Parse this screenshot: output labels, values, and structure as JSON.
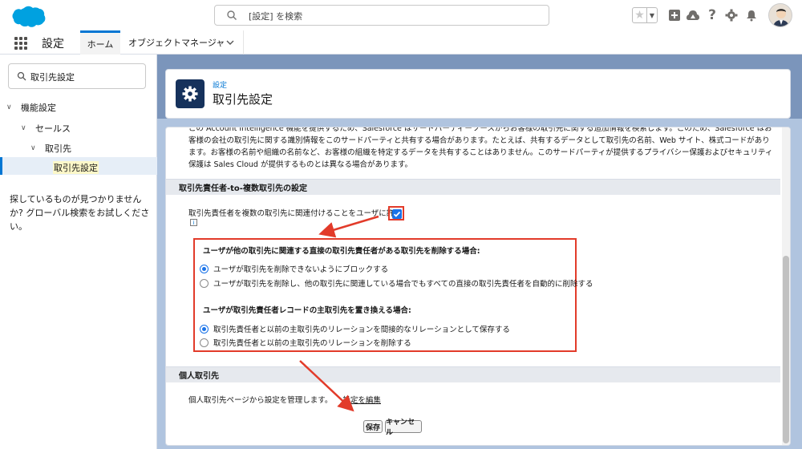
{
  "header": {
    "search_placeholder": "[設定] を検索"
  },
  "nav": {
    "app_name": "設定",
    "tabs": [
      {
        "label": "ホーム"
      },
      {
        "label": "オブジェクトマネージャ"
      }
    ]
  },
  "sidebar": {
    "quick_find_value": "取引先設定",
    "tree": [
      {
        "label": "機能設定"
      },
      {
        "label": "セールス"
      },
      {
        "label": "取引先"
      },
      {
        "label": "取引先設定"
      }
    ],
    "help_text": "探しているものが見つかりませんか? グローバル検索をお試しください。"
  },
  "page_header": {
    "breadcrumb": "設定",
    "title": "取引先設定"
  },
  "content": {
    "intro": "この Account Intelligence 機能を提供するため、Salesforce はサードパーティーソースからお客様の取引先に関する追加情報を検索します。このため、Salesforce はお客様の会社の取引先に関する識別情報をこのサードパーティと共有する場合があります。たとえば、共有するデータとして取引先の名前、Web サイト、株式コードがあります。お客様の名前や組織の名前など、お客様の組織を特定するデータを共有することはありません。このサードパーティが提供するプライバシー保護およびセキュリティ保護は Sales Cloud が提供するものとは異なる場合があります。",
    "section1_title": "取引先責任者-to-複数取引先の設定",
    "allow_label": "取引先責任者を複数の取引先に関連付けることをユーザに許可",
    "allow_checked": true,
    "info_glyph": "i",
    "q1_title": "ユーザが他の取引先に関連する直接の取引先責任者がある取引先を削除する場合:",
    "q1_options": [
      {
        "label": "ユーザが取引先を削除できないようにブロックする",
        "selected": true
      },
      {
        "label": "ユーザが取引先を削除し、他の取引先に関連している場合でもすべての直接の取引先責任者を自動的に削除する",
        "selected": false
      }
    ],
    "q2_title": "ユーザが取引先責任者レコードの主取引先を置き換える場合:",
    "q2_options": [
      {
        "label": "取引先責任者と以前の主取引先のリレーションを間接的なリレーションとして保存する",
        "selected": true
      },
      {
        "label": "取引先責任者と以前の主取引先のリレーションを削除する",
        "selected": false
      }
    ],
    "section2_title": "個人取引先",
    "person_text": "個人取引先ページから設定を管理します。",
    "person_link": "設定を編集",
    "save_label": "保存",
    "cancel_label": "キャンセル"
  },
  "colors": {
    "accent": "#0176d3",
    "highlight_red": "#e23b2a",
    "header_icon_bg": "#16325c"
  },
  "icons": [
    "salesforce-cloud-logo",
    "search-icon",
    "star-icon",
    "add-icon",
    "trailhead-icon",
    "help-icon",
    "gear-icon",
    "bell-icon",
    "avatar",
    "app-launcher-icon",
    "chevron-down-icon",
    "settings-gear-icon",
    "info-icon"
  ]
}
